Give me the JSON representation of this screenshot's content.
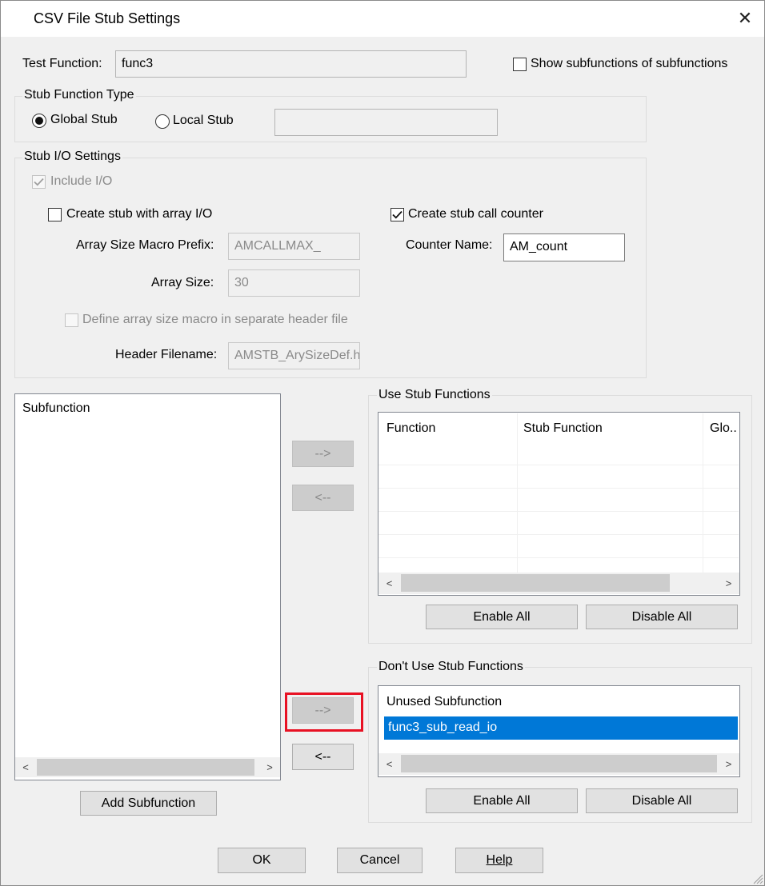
{
  "window": {
    "title": "CSV File Stub Settings",
    "close_icon": "close-icon"
  },
  "test_function": {
    "label": "Test Function:",
    "value": "func3"
  },
  "show_subfunctions": {
    "label": "Show subfunctions of subfunctions",
    "checked": false
  },
  "stub_function_type": {
    "title": "Stub Function Type",
    "global_label": "Global Stub",
    "local_label": "Local Stub",
    "selected": "Global Stub",
    "local_value": ""
  },
  "stub_io": {
    "title": "Stub I/O Settings",
    "include_io_label": "Include I/O",
    "array_io_label": "Create stub with array I/O",
    "call_counter_label": "Create stub call counter",
    "array_prefix_label": "Array Size Macro Prefix:",
    "array_prefix_value": "AMCALLMAX_",
    "counter_name_label": "Counter Name:",
    "counter_name_value": "AM_count",
    "array_size_label": "Array Size:",
    "array_size_value": "30",
    "define_macro_label": "Define array size macro in separate header file",
    "header_filename_label": "Header Filename:",
    "header_filename_value": "AMSTB_ArySizeDef.h"
  },
  "subfunction_list": {
    "header": "Subfunction",
    "add_button": "Add Subfunction"
  },
  "transfer": {
    "add_arrow": "-->",
    "remove_arrow": "<--"
  },
  "use_stub": {
    "title": "Use Stub Functions",
    "columns": [
      "Function",
      "Stub Function",
      "Glo.."
    ],
    "enable_all": "Enable All",
    "disable_all": "Disable All"
  },
  "dont_use_stub": {
    "title": "Don't Use Stub Functions",
    "header": "Unused Subfunction",
    "items": [
      "func3_sub_read_io"
    ],
    "enable_all": "Enable All",
    "disable_all": "Disable All"
  },
  "footer": {
    "ok": "OK",
    "cancel": "Cancel",
    "help": "Help"
  },
  "colors": {
    "selection": "#0078d7",
    "highlight": "#e81123",
    "dialog_bg": "#f0f0f0"
  }
}
